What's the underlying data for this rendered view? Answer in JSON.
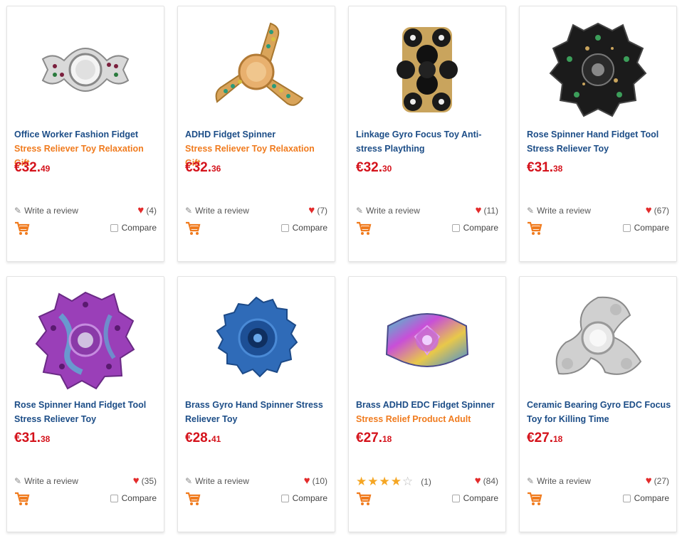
{
  "products": [
    {
      "title1": "Office Worker Fashion Fidget",
      "title2": "Stress Reliever Toy Relaxation Gift",
      "title2_color": "orange",
      "price_main": "€32.",
      "price_cents": "49",
      "review_label": "Write a review",
      "likes": "(4)",
      "compare_label": "Compare",
      "image_icon": "silver-spinner-icon"
    },
    {
      "title1": "ADHD Fidget Spinner",
      "title2": "Stress Reliever Toy Relaxation Gift",
      "title2_color": "orange",
      "price_main": "€32.",
      "price_cents": "36",
      "review_label": "Write a review",
      "likes": "(7)",
      "compare_label": "Compare",
      "image_icon": "gold-spinner-icon"
    },
    {
      "title1": "Linkage Gyro Focus Toy Anti-",
      "title2": "stress Plaything",
      "title2_color": "blue",
      "price_main": "€32.",
      "price_cents": "30",
      "review_label": "Write a review",
      "likes": "(11)",
      "compare_label": "Compare",
      "image_icon": "linkage-gyro-icon"
    },
    {
      "title1": "Rose Spinner Hand Fidget Tool",
      "title2": "Stress Reliever Toy",
      "title2_color": "blue",
      "price_main": "€31.",
      "price_cents": "38",
      "review_label": "Write a review",
      "likes": "(67)",
      "compare_label": "Compare",
      "image_icon": "black-rose-spinner-icon"
    },
    {
      "title1": "Rose Spinner Hand Fidget Tool",
      "title2": "Stress Reliever Toy",
      "title2_color": "blue",
      "price_main": "€31.",
      "price_cents": "38",
      "review_label": "Write a review",
      "likes": "(35)",
      "compare_label": "Compare",
      "image_icon": "purple-rose-spinner-icon"
    },
    {
      "title1": "Brass Gyro Hand Spinner Stress",
      "title2": "Reliever Toy",
      "title2_color": "blue",
      "price_main": "€28.",
      "price_cents": "41",
      "review_label": "Write a review",
      "likes": "(10)",
      "compare_label": "Compare",
      "image_icon": "blue-gear-spinner-icon"
    },
    {
      "title1": "Brass ADHD EDC Fidget Spinner",
      "title2": "Stress Relief Product Adult",
      "title2_color": "orange",
      "price_main": "€27.",
      "price_cents": "18",
      "review_label": "",
      "rating": 4,
      "rating_count": "(1)",
      "likes": "(84)",
      "compare_label": "Compare",
      "image_icon": "rainbow-spinner-icon"
    },
    {
      "title1": "Ceramic Bearing Gyro EDC Focus",
      "title2": "Toy for Killing Time",
      "title2_color": "blue",
      "price_main": "€27.",
      "price_cents": "18",
      "review_label": "Write a review",
      "likes": "(27)",
      "compare_label": "Compare",
      "image_icon": "silver-tri-spinner-icon"
    }
  ],
  "colors": {
    "link": "#1c4d87",
    "accent": "#f07b1e",
    "price": "#d4121b",
    "heart": "#e32b2b",
    "star": "#f5a623"
  }
}
